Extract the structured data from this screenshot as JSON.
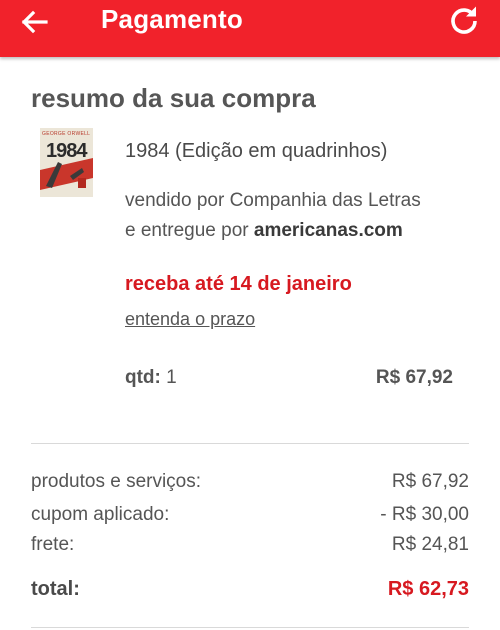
{
  "header": {
    "title": "Pagamento",
    "back_icon": "arrow-left-icon",
    "refresh_icon": "refresh-icon",
    "background_color": "#f1222b"
  },
  "summary": {
    "title": "resumo da sua compra",
    "product": {
      "cover_author": "GEORGE ORWELL",
      "cover_title": "1984",
      "name": "1984 (Edição em quadrinhos)",
      "seller_prefix": "vendido por",
      "seller": "Companhia das Letras",
      "delivery_prefix": "e entregue por",
      "delivery_by": "americanas.com",
      "receive_by": "receba até 14 de janeiro",
      "deadline_link": "entenda o prazo",
      "qty_label": "qtd:",
      "qty_value": "1",
      "price": "R$ 67,92"
    }
  },
  "totals": {
    "rows": [
      {
        "label": "produtos e serviços:",
        "value": "R$ 67,92"
      },
      {
        "label": "cupom aplicado:",
        "value": "- R$ 30,00"
      },
      {
        "label": "frete:",
        "value": "R$ 24,81"
      }
    ],
    "total_label": "total:",
    "total_value": "R$ 62,73",
    "total_color": "#d71920"
  }
}
